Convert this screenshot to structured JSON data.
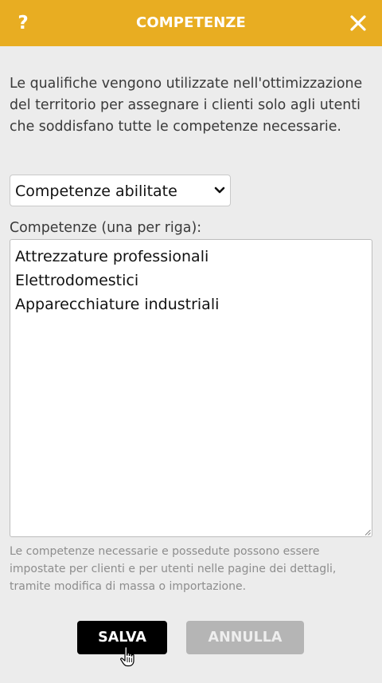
{
  "header": {
    "help_label": "?",
    "title": "COMPETENZE",
    "close_label": "close"
  },
  "intro_text": "Le qualifiche vengono utilizzate nell'ottimizzazione del territorio per assegnare i clienti solo agli utenti che soddisfano tutte le competenze necessarie.",
  "select": {
    "value": "Competenze abilitate"
  },
  "skills_field": {
    "label": "Competenze (una per riga):",
    "lines": [
      "Attrezzature professionali",
      "Elettrodomestici",
      "Apparecchiature industriali"
    ]
  },
  "hint_text": "Le competenze necessarie e possedute possono essere impostate per clienti e per utenti nelle pagine dei dettagli, tramite modifica di massa o importazione.",
  "buttons": {
    "save_label": "SALVA",
    "cancel_label": "ANNULLA"
  },
  "colors": {
    "header_bg": "#e8ad22",
    "page_bg": "#ececec",
    "save_bg": "#000000",
    "cancel_bg": "#b5b5b5"
  },
  "icons": {
    "help": "question-mark-icon",
    "close": "close-icon",
    "select": "chevron-down-icon",
    "cursor": "hand-pointer-icon"
  }
}
